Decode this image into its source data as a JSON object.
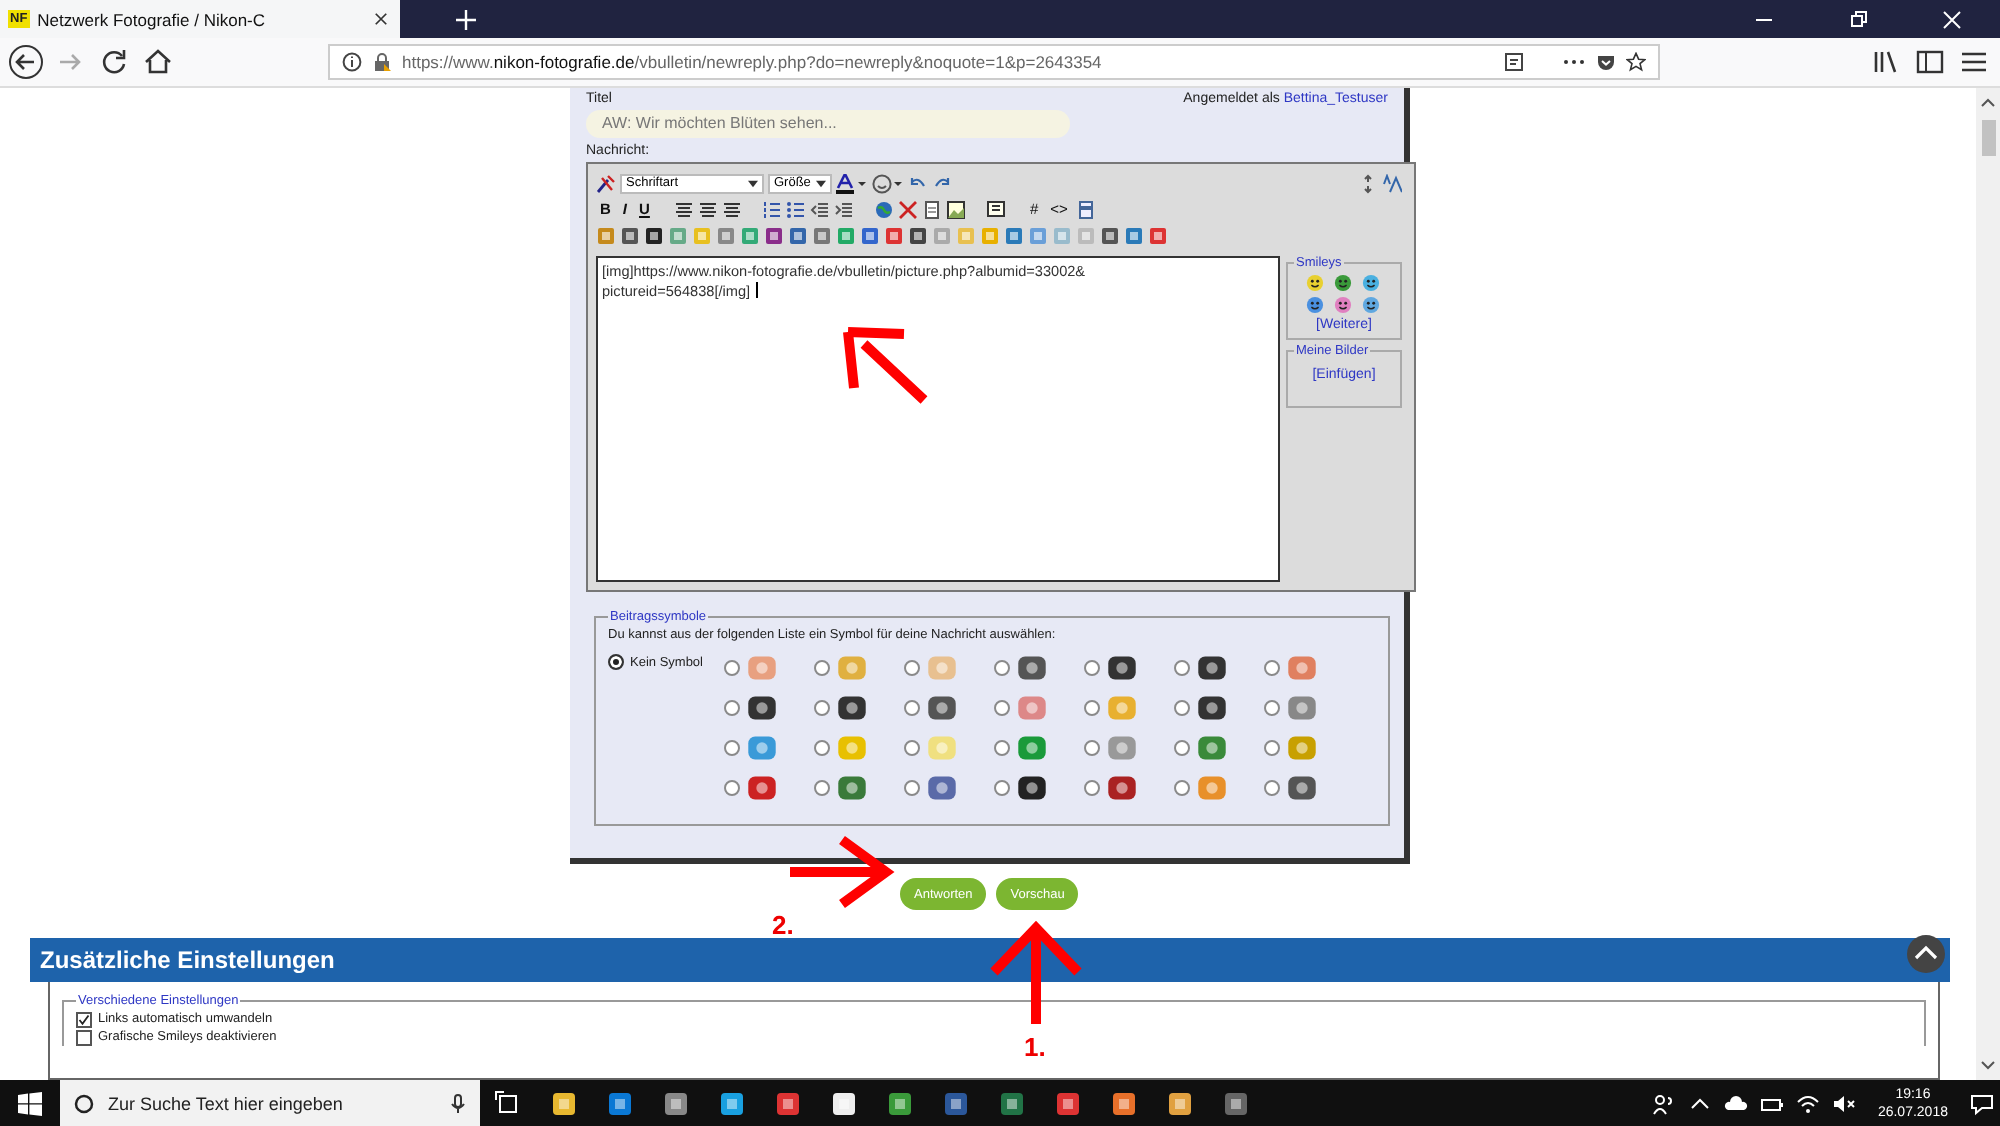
{
  "browser": {
    "tab": {
      "favicon": "NF",
      "title": "Netzwerk Fotografie / Nikon-C"
    },
    "url": {
      "prefix": "https://www.",
      "domain": "nikon-fotografie.de",
      "path": "/vbulletin/newreply.php?do=newreply&noquote=1&p=2643354"
    }
  },
  "form": {
    "title_label": "Titel",
    "logged_in_label": "Angemeldet als",
    "user": "Bettina_Testuser",
    "title_value": "AW: Wir möchten Blüten sehen...",
    "message_label": "Nachricht:"
  },
  "editor": {
    "font_select": "Schriftart",
    "size_select": "Größe",
    "format_buttons": [
      "B",
      "I",
      "U"
    ],
    "code_buttons": [
      "#",
      "<>"
    ],
    "message": "[img]https://www.nikon-fotografie.de/vbulletin/picture.php?albumid=33002&\npictureid=564838[/img]",
    "smileys": {
      "legend": "Smileys",
      "more": "[Weitere]"
    },
    "my_images": {
      "legend": "Meine Bilder",
      "insert": "[Einfügen]"
    }
  },
  "post_icons": {
    "legend": "Beitragssymbole",
    "hint": "Du kannst aus der folgenden Liste ein Symbol für deine Nachricht auswählen:",
    "options": [
      {
        "label": "Kein Symbol",
        "selected": true
      },
      {
        "selected": false
      },
      {
        "selected": false
      },
      {
        "selected": false
      },
      {
        "selected": false
      },
      {
        "selected": false
      },
      {
        "selected": false
      },
      {
        "selected": false
      },
      {
        "selected": false
      },
      {
        "selected": false
      },
      {
        "selected": false
      },
      {
        "selected": false
      },
      {
        "selected": false
      },
      {
        "selected": false
      },
      {
        "selected": false
      },
      {
        "selected": false
      },
      {
        "selected": false
      },
      {
        "selected": false
      },
      {
        "selected": false
      },
      {
        "selected": false
      },
      {
        "selected": false
      },
      {
        "selected": false
      },
      {
        "selected": false
      },
      {
        "selected": false
      },
      {
        "selected": false
      },
      {
        "selected": false
      },
      {
        "selected": false
      },
      {
        "selected": false
      },
      {
        "selected": false
      }
    ]
  },
  "buttons": [
    "Antworten",
    "Vorschau"
  ],
  "extra_settings": {
    "title": "Zusätzliche Einstellungen",
    "group": "Verschiedene Einstellungen",
    "options": [
      {
        "label": "Links automatisch umwandeln",
        "checked": true
      },
      {
        "label": "Grafische Smileys deaktivieren",
        "checked": false
      }
    ]
  },
  "annotations": {
    "step_labels": [
      "1.",
      "2."
    ]
  },
  "taskbar": {
    "search_placeholder": "Zur Suche Text hier eingeben",
    "time": "19:16",
    "date": "26.07.2018"
  }
}
